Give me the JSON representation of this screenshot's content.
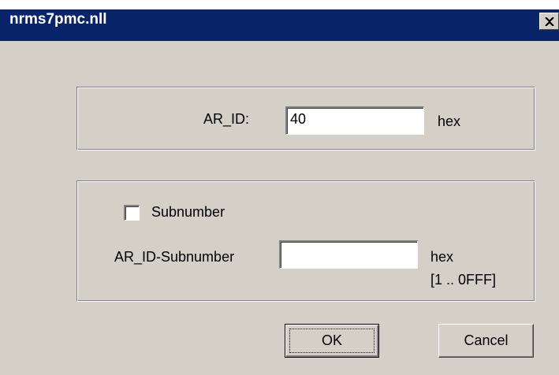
{
  "window": {
    "title": "nrms7pmc.nll",
    "close_icon": "close-icon"
  },
  "group_ar_id": {
    "label": "AR_ID:",
    "value": "40",
    "unit": "hex"
  },
  "group_subnumber": {
    "checkbox_label": "Subnumber",
    "checked": false,
    "field_label": "AR_ID-Subnumber",
    "value": "",
    "unit": "hex",
    "range": "[1 .. 0FFF]"
  },
  "buttons": {
    "ok": "OK",
    "cancel": "Cancel"
  },
  "colors": {
    "titlebar": "#0a246a",
    "face": "#d4d0c8"
  }
}
